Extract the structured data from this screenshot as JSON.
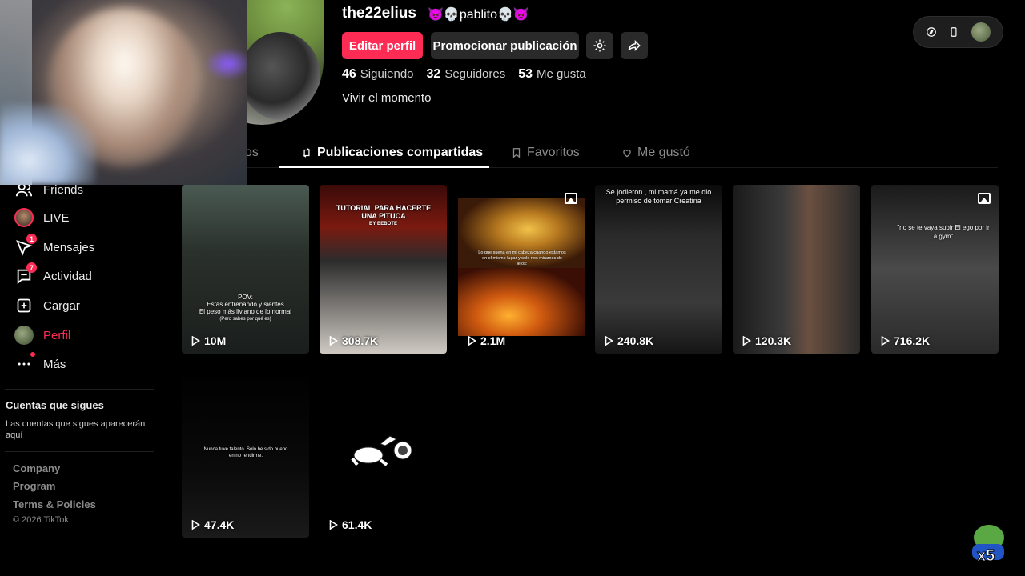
{
  "profile": {
    "username": "the22elius",
    "nickname": "👿💀pablito💀👿",
    "edit_button": "Editar perfil",
    "promote_button": "Promocionar publicación",
    "stats": [
      {
        "value": "46",
        "label": "Siguiendo"
      },
      {
        "value": "32",
        "label": "Seguidores"
      },
      {
        "value": "53",
        "label": "Me gusta"
      }
    ],
    "bio": "Vivir el momento"
  },
  "tabs": {
    "videos": "Videos",
    "videos_visible": "os",
    "reposts": "Publicaciones compartidas",
    "favorites": "Favoritos",
    "liked": "Me gustó"
  },
  "sidebar": {
    "items": [
      {
        "label": "Friends"
      },
      {
        "label": "LIVE"
      },
      {
        "label": "Mensajes",
        "badge": "1"
      },
      {
        "label": "Actividad",
        "badge": "7"
      },
      {
        "label": "Cargar"
      },
      {
        "label": "Perfil"
      },
      {
        "label": "Más"
      }
    ],
    "following_title": "Cuentas que sigues",
    "following_desc": "Las cuentas que sigues aparecerán aquí",
    "footer": [
      "Company",
      "Program",
      "Terms & Policies"
    ],
    "copyright": "© 2026 TikTok"
  },
  "grid": {
    "cards": [
      {
        "views": "10M",
        "text1": "POV:",
        "text2": "Estás entrenando y sientes",
        "text3": "El peso más liviano de lo normal",
        "text4": "(Pero sabes por qué es)"
      },
      {
        "views": "308.7K",
        "title": "TUTORIAL PARA HACERTE UNA PITUCA",
        "subtitle": "BY BEBOTE"
      },
      {
        "views": "2.1M",
        "text": "Lo que suena en mi cabeza cuando estamos en el mismo lugar y solo nos miramos de lejos:"
      },
      {
        "views": "240.8K",
        "text": "Se jodieron , mi mamá ya me dio permiso de tomar Creatina"
      },
      {
        "views": "120.3K"
      },
      {
        "views": "716.2K",
        "text": "\"no se te vaya subir El ego por ir a  gym\""
      },
      {
        "views": "47.4K",
        "text": "Nunca tuve talento. Solo he sido bueno en no rendirme."
      },
      {
        "views": "61.4K"
      }
    ]
  },
  "overlay": {
    "badge": "x5"
  }
}
